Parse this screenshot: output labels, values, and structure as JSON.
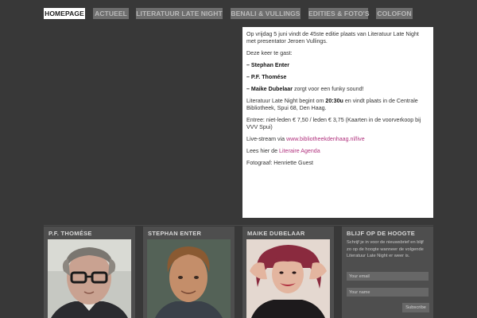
{
  "nav": {
    "items": [
      {
        "label": "Homepage",
        "active": true
      },
      {
        "label": "Actueel"
      },
      {
        "label": "Literatuur Late Night"
      },
      {
        "label": "Benali & Vullings"
      },
      {
        "label": "Edities & Foto's"
      },
      {
        "label": "Colofon"
      }
    ]
  },
  "content": {
    "intro": "Op vrijdag 5 juni vindt de 45ste editie plaats van Literatuur Late Night met presentator Jeroen Vullings.",
    "guests_intro": "Deze keer te gast:",
    "guest1": "– Stephan Enter",
    "guest2": "– P.F. Thomése",
    "guest3_name": "– Maike Dubelaar",
    "guest3_rest": " zorgt voor een funky sound!",
    "time_pre": "Literatuur Late Night begint om ",
    "time": "20:30u",
    "time_post": " en vindt plaats in de Centrale Bibliotheek, Spui 68, Den Haag.",
    "entry": "Entree: niet-leden € 7,50 / leden € 3,75 (Kaarten in de voorverkoop bij VVV Spui)",
    "livestream_pre": "Live-stream via ",
    "livestream_link": "www.bibliotheekdenhaag.nl/live",
    "agenda_pre": "Lees hier de ",
    "agenda_link": "Literaire Agenda",
    "photographer": "Fotograaf: Henriette Guest"
  },
  "cards": [
    {
      "title": "P.F. Thomése"
    },
    {
      "title": "Stephan Enter"
    },
    {
      "title": "Maike Dubelaar"
    }
  ],
  "newsletter": {
    "title": "Blijf op de hoogte",
    "text": "Schrijf je in voor de nieuwsbrief en blijf zo op de hoogte wanneer de volgende Literatuur Late Night er weer is.",
    "email_placeholder": "Your email",
    "name_placeholder": "Your name",
    "subscribe_label": "Subscribe"
  },
  "colors": {
    "background": "#383838",
    "nav_inactive": "#6e6e6e",
    "nav_active": "#ffffff",
    "link": "#b0317d",
    "card": "#4e4e4e"
  }
}
